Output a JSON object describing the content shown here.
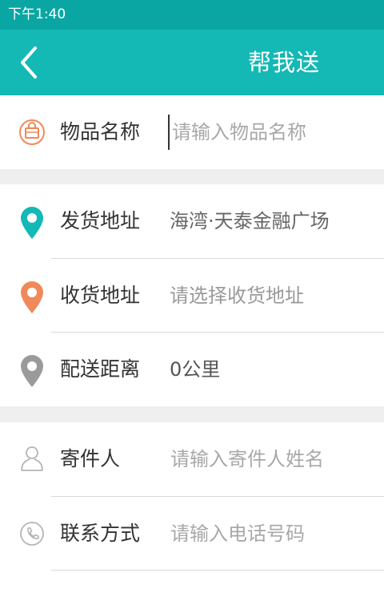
{
  "status_bar": {
    "time": "下午1:40"
  },
  "nav": {
    "title": "帮我送",
    "back_icon": "chevron-left-icon"
  },
  "item": {
    "label": "物品名称",
    "placeholder": "请输入物品名称"
  },
  "address": {
    "sender_label": "发货地址",
    "sender_value": "海湾·天泰金融广场",
    "receiver_label": "收货地址",
    "receiver_value": "请选择收货地址",
    "distance_label": "配送距离",
    "distance_value": "0公里"
  },
  "contact": {
    "sender_name_label": "寄件人",
    "sender_name_placeholder": "请输入寄件人姓名",
    "phone_label": "联系方式",
    "phone_placeholder": "请输入电话号码"
  },
  "colors": {
    "accent": "#14b8b5",
    "orange": "#f0895a",
    "gray_pin": "#9a9a9a"
  }
}
